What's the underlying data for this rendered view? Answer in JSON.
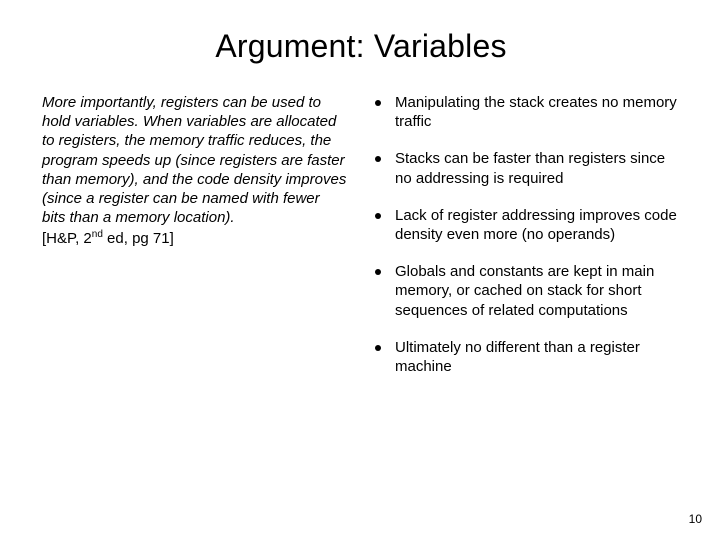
{
  "title": "Argument: Variables",
  "left": {
    "quote": "More importantly, registers can be used to hold variables. When variables are allocated to registers, the memory traffic reduces, the program speeds up (since registers are faster than memory), and the code density improves (since a register can be named with fewer bits than a memory location).",
    "citation_prefix": " [H&P, 2",
    "citation_sup": "nd",
    "citation_suffix": " ed, pg 71]"
  },
  "bullets": [
    "Manipulating the stack creates no memory traffic",
    "Stacks can be faster than registers since no addressing is required",
    "Lack of register addressing improves code density even more (no operands)",
    "Globals and constants are kept in main memory, or cached on stack for short sequences of related computations",
    "Ultimately no different than a register machine"
  ],
  "page_number": "10"
}
